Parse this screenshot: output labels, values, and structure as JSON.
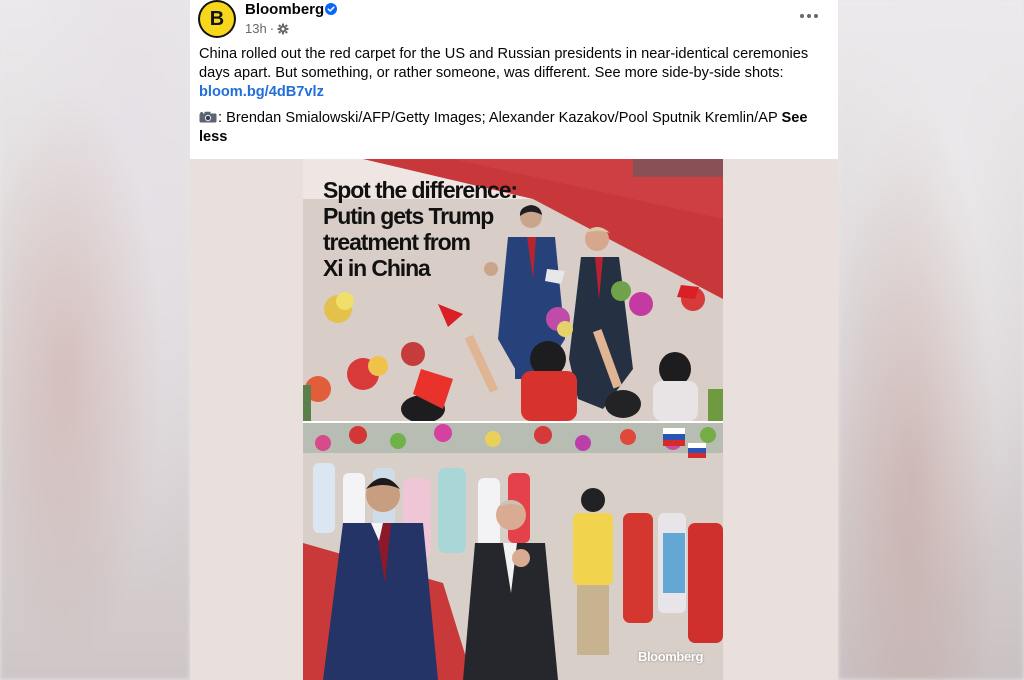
{
  "page": {
    "name": "Bloomberg",
    "avatar_letter": "B",
    "timestamp": "13h",
    "separator": "·"
  },
  "post": {
    "text": "China rolled out the red carpet for the US and Russian presidents in near-identical ceremonies days apart. But something, or rather someone, was different. See more side-by-side shots:",
    "link": "bloom.bg/4dB7vlz",
    "credit": ": Brendan Smialowski/AFP/Getty Images; Alexander Kazakov/Pool Sputnik Kremlin/AP",
    "see_less": "See less"
  },
  "media": {
    "headline_lines": [
      "Spot the difference:",
      "Putin gets Trump",
      "treatment from",
      "Xi in China"
    ],
    "watermark": "Bloomberg"
  },
  "icons": {
    "verified": "verified-badge-icon",
    "audience": "gear-icon",
    "more": "more-options-icon",
    "camera": "camera-icon"
  },
  "colors": {
    "brand_yellow": "#f8d61b",
    "link_blue": "#216fdb",
    "verified_blue": "#0866ff",
    "red_carpet": "#c8383a"
  }
}
